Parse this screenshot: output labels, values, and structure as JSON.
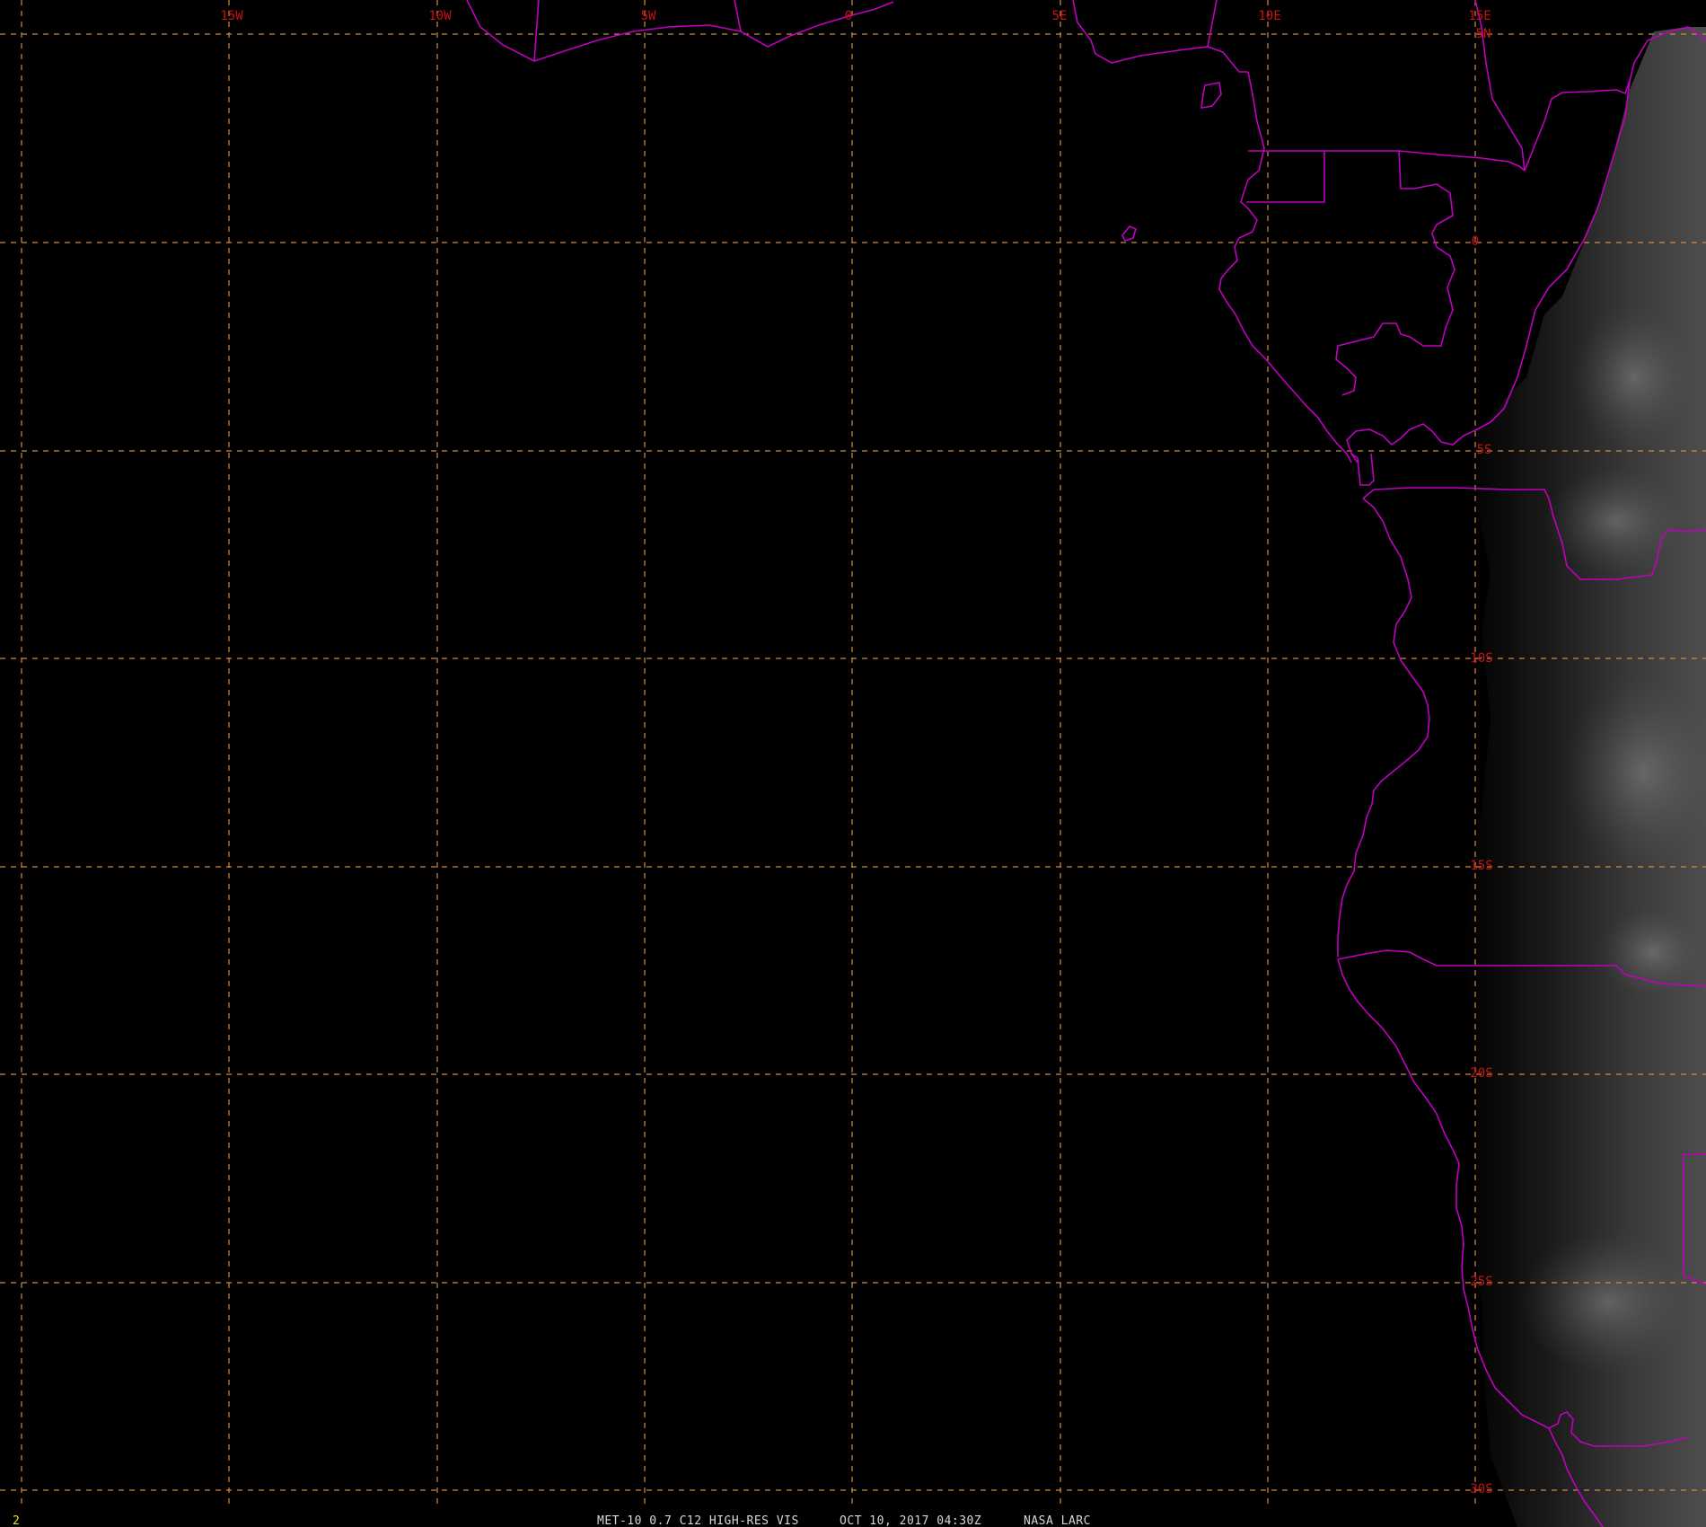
{
  "colors": {
    "background": "#000000",
    "graticule": "#d08a45",
    "grid_labels": "#cc1111",
    "boundaries": "#c000c0",
    "caption": "#d8d8d8",
    "frame_number": "#e6e600"
  },
  "longitude_labels": [
    "15W",
    "10W",
    "5W",
    "0",
    "5E",
    "10E",
    "15E"
  ],
  "latitude_labels": [
    "5N",
    "0",
    "5S",
    "10S",
    "15S",
    "20S",
    "25S",
    "30S"
  ],
  "caption": {
    "sensor": "MET-10 0.7 C12 HIGH-RES VIS",
    "datetime": "OCT 10, 2017 04:30Z",
    "source": "NASA LARC"
  },
  "frame_number": "2"
}
